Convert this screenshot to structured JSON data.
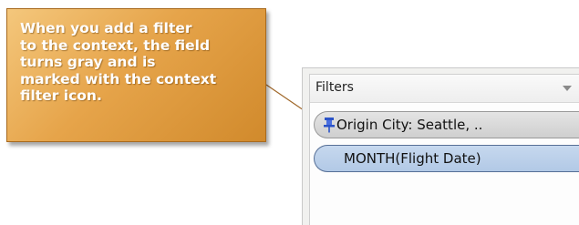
{
  "callout": {
    "text": "When you add a filter\nto the context, the field\nturns gray and is\nmarked with the context\nfilter icon."
  },
  "filters_panel": {
    "title": "Filters",
    "menu_icon": "dropdown-arrow-icon",
    "items": [
      {
        "label": "Origin City: Seattle, ..",
        "icon": "context-filter-pin-icon",
        "state": "context"
      },
      {
        "label": "MONTH(Flight Date)",
        "state": "normal"
      }
    ]
  },
  "colors": {
    "callout_fill": "#e6a44a",
    "callout_border": "#a86a1e",
    "context_pill": "#d9d9d9",
    "normal_pill": "#b9cfe9",
    "pin_icon": "#2b53c8"
  }
}
